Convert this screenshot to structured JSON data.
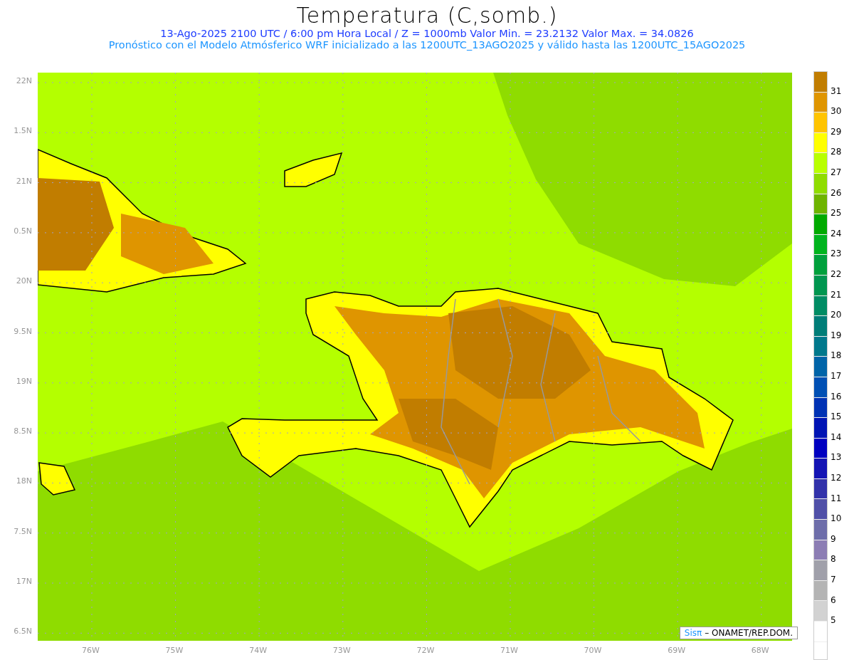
{
  "title": "Temperatura (C,somb.)",
  "subtitle_lines": [
    "13-Ago-2025  2100 UTC / 6:00 pm Hora Local / Z = 1000mb   Valor Min. = 23.2132  Valor Max. = 34.0826",
    "Pronóstico con el Modelo Atmósferico WRF inicializado a las 1200UTC_13AGO2025 y válido hasta las  1200UTC_15AGO2025"
  ],
  "map": {
    "lat_labels": [
      "22N",
      "1.5N",
      "21N",
      "0.5N",
      "20N",
      "9.5N",
      "19N",
      "8.5N",
      "18N",
      "7.5N",
      "17N",
      "6.5N"
    ],
    "lon_labels": [
      "76W",
      "75W",
      "74W",
      "73W",
      "72W",
      "71W",
      "70W",
      "69W",
      "68W"
    ],
    "credit": {
      "brand": "Sisπ",
      "text": "– ONAMET/REP.DOM."
    }
  },
  "colorbar": {
    "segments": [
      {
        "color": "#c17d00"
      },
      {
        "color": "#df9500"
      },
      {
        "color": "#ffc400"
      },
      {
        "color": "#ffff00"
      },
      {
        "color": "#b9ff00"
      },
      {
        "color": "#8fdc00"
      },
      {
        "color": "#6eb400"
      },
      {
        "color": "#00aa00"
      },
      {
        "color": "#00b41e"
      },
      {
        "color": "#00a03c"
      },
      {
        "color": "#009650"
      },
      {
        "color": "#008c64"
      },
      {
        "color": "#007d78"
      },
      {
        "color": "#00788c"
      },
      {
        "color": "#0064a8"
      },
      {
        "color": "#0050b4"
      },
      {
        "color": "#0032b4"
      },
      {
        "color": "#0014b4"
      },
      {
        "color": "#0000c0"
      },
      {
        "color": "#1414b4"
      },
      {
        "color": "#3232aa"
      },
      {
        "color": "#5050a8"
      },
      {
        "color": "#6e6eaa"
      },
      {
        "color": "#8c7db4"
      },
      {
        "color": "#a0a0aa"
      },
      {
        "color": "#b4b4b4"
      },
      {
        "color": "#d2d2d2"
      },
      {
        "color": "#ffffff"
      }
    ],
    "labels": [
      "31",
      "30",
      "29",
      "28",
      "27",
      "26",
      "25",
      "24",
      "23",
      "22",
      "21",
      "20",
      "19",
      "18",
      "17",
      "16",
      "15",
      "14",
      "13",
      "12",
      "11",
      "10",
      "9",
      "8",
      "7",
      "6",
      "5"
    ]
  }
}
